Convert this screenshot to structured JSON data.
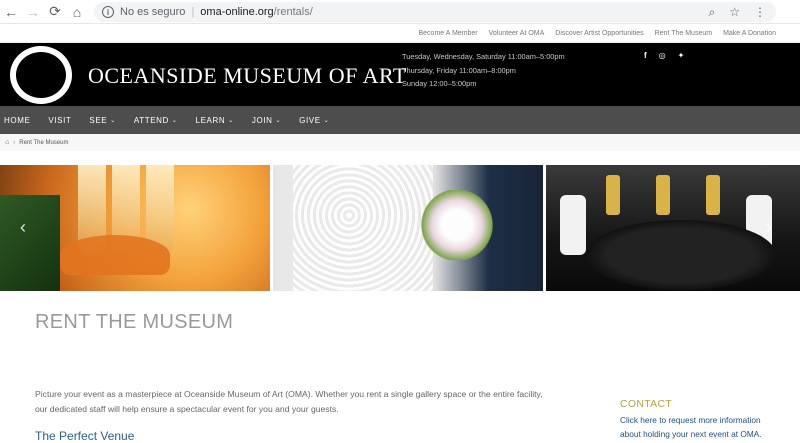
{
  "browser": {
    "security_label": "No es seguro",
    "url_host": "oma-online.org",
    "url_path": "/rentals/"
  },
  "utility_links": [
    "Become A Member",
    "Volunteer At OMA",
    "Discover Artist Opportunities",
    "Rent The Museum",
    "Make A Donation"
  ],
  "header": {
    "title": "OCEANSIDE MUSEUM OF ART",
    "hours": [
      "Tuesday, Wednesday, Saturday 11:00am–5:00pm",
      "Thursday, Friday 11:00am–8:00pm",
      "Sunday 12:00–5:00pm"
    ],
    "social": [
      "f",
      "◎",
      "🐦"
    ]
  },
  "nav": [
    {
      "label": "HOME",
      "dropdown": false
    },
    {
      "label": "VISIT",
      "dropdown": false
    },
    {
      "label": "SEE",
      "dropdown": true
    },
    {
      "label": "ATTEND",
      "dropdown": true
    },
    {
      "label": "LEARN",
      "dropdown": true
    },
    {
      "label": "JOIN",
      "dropdown": true
    },
    {
      "label": "GIVE",
      "dropdown": true
    }
  ],
  "breadcrumb": {
    "current": "Rent The Museum"
  },
  "content": {
    "title": "RENT THE MUSEUM",
    "intro": "Picture your event as a masterpiece at Oceanside Museum of Art (OMA). Whether you rent a single gallery space or the entire facility, our dedicated staff will help ensure a spectacular event for you and your guests.",
    "subhead": "The Perfect Venue",
    "contact_heading": "CONTACT",
    "contact_text": "Click here to request more information about holding your next event at OMA."
  }
}
